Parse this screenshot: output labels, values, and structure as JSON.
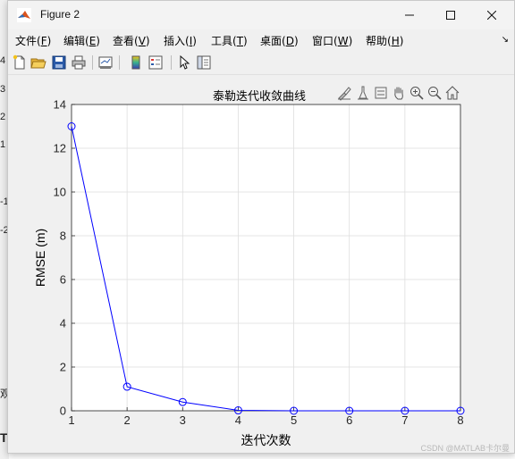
{
  "window": {
    "title": "Figure 2",
    "controls": {
      "minimize": "minimize",
      "maximize": "maximize",
      "close": "close"
    }
  },
  "menu": {
    "items": [
      {
        "label": "文件(",
        "key": "F",
        "end": ")"
      },
      {
        "label": "编辑(",
        "key": "E",
        "end": ")"
      },
      {
        "label": "查看(",
        "key": "V",
        "end": ")"
      },
      {
        "label": "插入(",
        "key": "I",
        "end": ")"
      },
      {
        "label": "工具(",
        "key": "T",
        "end": ")"
      },
      {
        "label": "桌面(",
        "key": "D",
        "end": ")"
      },
      {
        "label": "窗口(",
        "key": "W",
        "end": ")"
      },
      {
        "label": "帮助(",
        "key": "H",
        "end": ")"
      }
    ]
  },
  "toolbar": {
    "icons": [
      "new-figure-icon",
      "open-file-icon",
      "save-icon",
      "print-icon",
      "link-plot-icon",
      "colorbar-icon",
      "legend-icon",
      "pointer-icon",
      "property-inspector-icon"
    ]
  },
  "axes_toolbar": {
    "icons": [
      "brush-icon",
      "data-tips-icon",
      "restore-view-icon",
      "pan-icon",
      "zoom-in-icon",
      "zoom-out-icon",
      "home-icon"
    ]
  },
  "behind_window": {
    "fragments": [
      "4",
      "3",
      "2",
      "1",
      "-1",
      "-2",
      "观",
      "T"
    ]
  },
  "chart_data": {
    "type": "line",
    "title": "泰勒迭代收敛曲线",
    "xlabel": "迭代次数",
    "ylabel": "RMSE (m)",
    "x": [
      1,
      2,
      3,
      4,
      5,
      6,
      7,
      8
    ],
    "series": [
      {
        "values": [
          13.0,
          1.1,
          0.4,
          0.02,
          0.0,
          0.0,
          0.0,
          0.0
        ],
        "color": "#0000ff",
        "marker": "circle"
      }
    ],
    "xlim": [
      1,
      8
    ],
    "ylim": [
      0,
      14
    ],
    "xticks": [
      "1",
      "2",
      "3",
      "4",
      "5",
      "6",
      "7",
      "8"
    ],
    "yticks": [
      "0",
      "2",
      "4",
      "6",
      "8",
      "10",
      "12",
      "14"
    ],
    "grid": true
  },
  "watermark": "CSDN @MATLAB卡尔曼"
}
